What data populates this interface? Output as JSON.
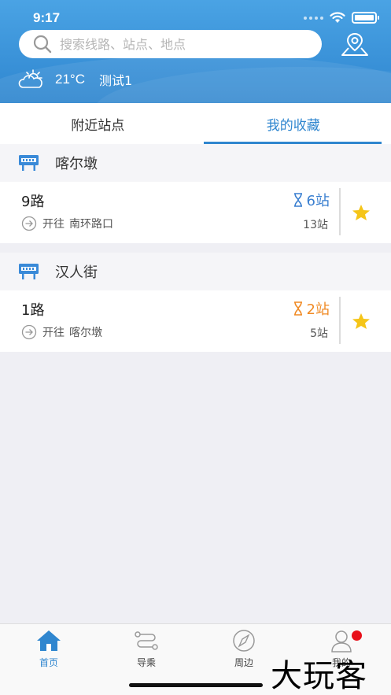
{
  "status_bar": {
    "time": "9:17"
  },
  "search": {
    "placeholder": "搜索线路、站点、地点"
  },
  "weather": {
    "temperature": "21°C",
    "location": "测试1"
  },
  "tabs": [
    {
      "label": "附近站点",
      "active": false
    },
    {
      "label": "我的收藏",
      "active": true
    }
  ],
  "stations": [
    {
      "name": "喀尔墩",
      "route": {
        "name": "9路",
        "eta": "6站",
        "eta_color": "#3a7fd0",
        "direction_label": "开往",
        "destination": "南环路口",
        "distance": "13站"
      }
    },
    {
      "name": "汉人街",
      "route": {
        "name": "1路",
        "eta": "2站",
        "eta_color": "#f08a24",
        "direction_label": "开往",
        "destination": "喀尔墩",
        "distance": "5站"
      }
    }
  ],
  "tabbar": [
    {
      "label": "首页",
      "icon": "home-icon",
      "active": true
    },
    {
      "label": "导乘",
      "icon": "route-icon",
      "active": false
    },
    {
      "label": "周边",
      "icon": "compass-icon",
      "active": false
    },
    {
      "label": "我的",
      "icon": "user-icon",
      "active": false
    }
  ],
  "watermark": "大玩客",
  "colors": {
    "accent": "#2f86cf",
    "star": "#f5c518",
    "badge": "#e8101a"
  }
}
